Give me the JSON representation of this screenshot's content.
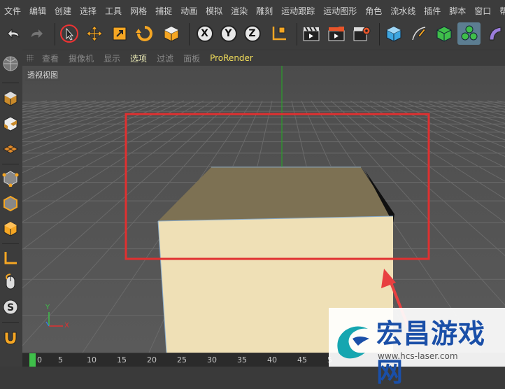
{
  "menu": {
    "items": [
      "文件",
      "编辑",
      "创建",
      "选择",
      "工具",
      "网格",
      "捕捉",
      "动画",
      "模拟",
      "渲染",
      "雕刻",
      "运动跟踪",
      "运动图形",
      "角色",
      "流水线",
      "插件",
      "脚本",
      "窗口",
      "帮助"
    ]
  },
  "toolbar": {
    "axes": [
      "X",
      "Y",
      "Z"
    ],
    "buttons": [
      "undo",
      "redo",
      "live-selection",
      "move",
      "scale",
      "rotate",
      "recent-object",
      "x-axis-lock",
      "y-axis-lock",
      "z-axis-lock",
      "coordinate-system",
      "render-view",
      "render-picture-viewer",
      "render-settings",
      "cube-primitive",
      "pen-spline",
      "subdivision-surface",
      "cloner",
      "deformer"
    ]
  },
  "viewport_menu": {
    "items": [
      "查看",
      "摄像机",
      "显示",
      "选项",
      "过滤",
      "面板",
      "ProRender"
    ],
    "active": "选项"
  },
  "viewport": {
    "label": "透视视图",
    "axis_y": "Y",
    "axis_x": "X"
  },
  "timeline": {
    "ticks": [
      "0",
      "5",
      "10",
      "15",
      "20",
      "25",
      "30",
      "35",
      "40",
      "45",
      "5"
    ]
  },
  "watermark": {
    "text": "宏昌游戏网",
    "url": "www.hcs-laser.com"
  },
  "colors": {
    "highlight_rect": "#e03030",
    "arrow": "#e84040",
    "cube_front": "#efe0b6",
    "cube_top": "#7d7153",
    "grid_bg": "#555555",
    "selected_button": "#5c7d91",
    "prorender": "#f0dc5a"
  }
}
